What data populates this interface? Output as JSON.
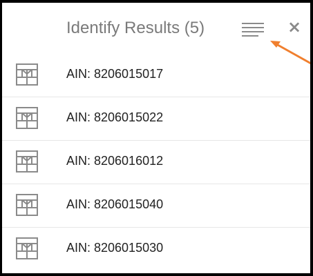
{
  "header": {
    "title": "Identify Results (5)",
    "menu_icon": "list-lines-icon",
    "close_icon": "close-icon",
    "close_glyph": "×"
  },
  "results": [
    {
      "label": "AIN: 8206015017",
      "icon": "parcel-icon"
    },
    {
      "label": "AIN: 8206015022",
      "icon": "parcel-icon"
    },
    {
      "label": "AIN: 8206016012",
      "icon": "parcel-icon"
    },
    {
      "label": "AIN: 8206015040",
      "icon": "parcel-icon"
    },
    {
      "label": "AIN: 8206015030",
      "icon": "parcel-icon"
    }
  ],
  "colors": {
    "arrow": "#f07f2e",
    "title": "#7a7a7a",
    "icon": "#8a8a8a",
    "border": "#000000"
  }
}
